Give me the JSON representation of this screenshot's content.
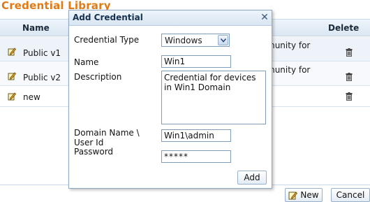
{
  "page": {
    "title": "Credential Library"
  },
  "table": {
    "columns": {
      "name": "Name",
      "delete": "Delete"
    },
    "rows": [
      {
        "name": "Public v1",
        "description_fragment": "munity for"
      },
      {
        "name": "Public v2",
        "description_fragment": "munity for"
      },
      {
        "name": "new",
        "description_fragment": ""
      }
    ]
  },
  "buttons": {
    "new": "New",
    "cancel": "Cancel"
  },
  "dialog": {
    "title": "Add Credential",
    "fields": {
      "type_label": "Credential Type",
      "type_value": "Windows",
      "name_label": "Name",
      "name_value": "Win1",
      "description_label": "Description",
      "description_value": "Credential for devices in Win1 Domain",
      "domain_label": "Domain Name \\ User Id",
      "domain_value": "Win1\\admin",
      "password_label": "Password",
      "password_value": "*****"
    },
    "add_label": "Add"
  },
  "icons": {
    "edit": "edit-icon",
    "delete": "trash-icon",
    "close": "close-icon",
    "new": "new-document-icon",
    "dropdown": "chevron-down-icon"
  },
  "colors": {
    "title": "#e07a14",
    "header_bg": "#dbe7f3",
    "border": "#8fa8c3"
  }
}
